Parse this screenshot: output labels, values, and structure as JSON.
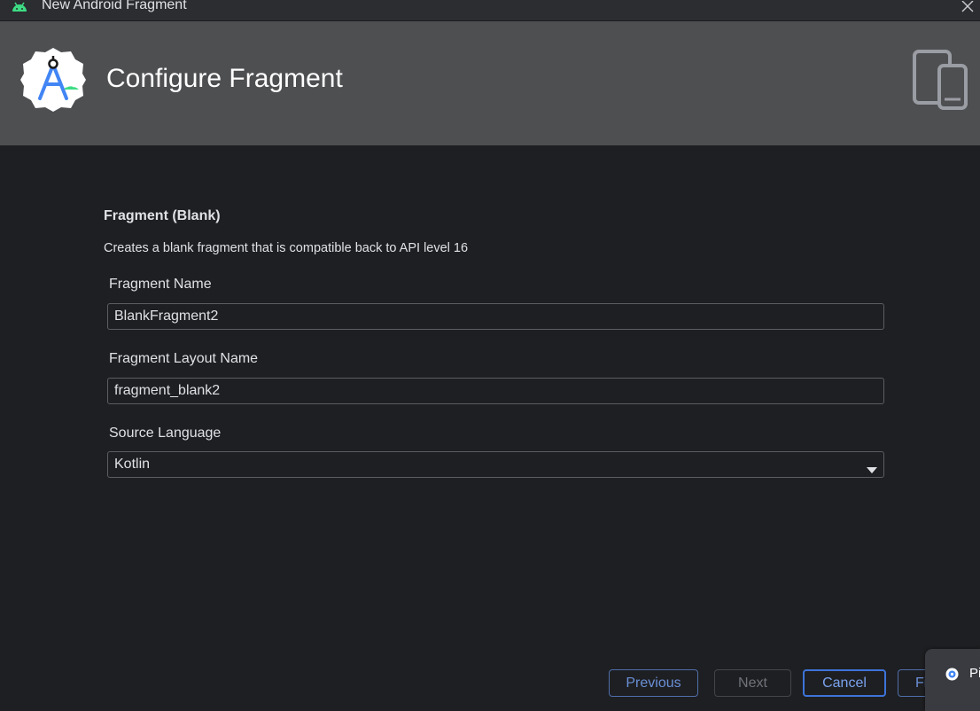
{
  "window": {
    "title": "New Android Fragment"
  },
  "banner": {
    "title": "Configure Fragment",
    "logo_icon": "android-studio-logo-icon",
    "device_icon": "phone-tablet-icon"
  },
  "template": {
    "title": "Fragment (Blank)",
    "description": "Creates a blank fragment that is compatible back to API level 16"
  },
  "fields": {
    "fragment_name": {
      "label": "Fragment Name",
      "value": "BlankFragment2"
    },
    "layout_name": {
      "label": "Fragment Layout Name",
      "value": "fragment_blank2"
    },
    "source_language": {
      "label": "Source Language",
      "value": "Kotlin"
    }
  },
  "buttons": {
    "previous": "Previous",
    "next": "Next",
    "cancel": "Cancel",
    "finish": "Fi"
  },
  "popup": {
    "text": "Pi",
    "line2": "..."
  },
  "colors": {
    "background": "#1e1f22",
    "banner": "#4e4f51",
    "accent": "#3d74d9",
    "android_green": "#3ddc84"
  }
}
